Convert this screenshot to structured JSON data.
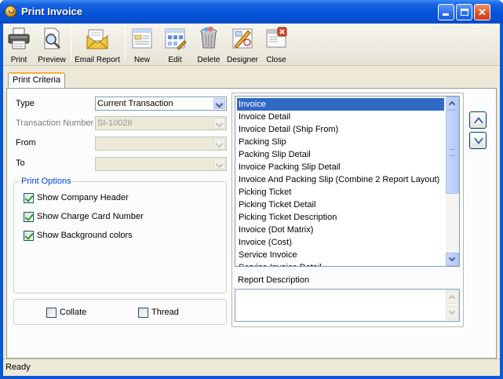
{
  "window": {
    "title": "Print Invoice"
  },
  "toolbar": {
    "print": "Print",
    "preview": "Preview",
    "email_report": "Email Report",
    "new": "New",
    "edit": "Edit",
    "delete": "Delete",
    "designer": "Designer",
    "close": "Close"
  },
  "tabs": {
    "print_criteria": "Print Criteria"
  },
  "form": {
    "type_label": "Type",
    "type_value": "Current Transaction",
    "transaction_number_label": "Transaction Number",
    "transaction_number_value": "SI-10026",
    "from_label": "From",
    "from_value": "",
    "to_label": "To",
    "to_value": ""
  },
  "print_options": {
    "legend": "Print Options",
    "items": [
      {
        "label": "Show Company Header",
        "checked": true
      },
      {
        "label": "Show Charge Card Number",
        "checked": true
      },
      {
        "label": "Show Background colors",
        "checked": true
      }
    ]
  },
  "bottom_options": {
    "collate": {
      "label": "Collate",
      "checked": false
    },
    "thread": {
      "label": "Thread",
      "checked": false
    }
  },
  "reports": {
    "selected": "Invoice",
    "items": [
      "Invoice",
      "Invoice Detail",
      "Invoice Detail (Ship From)",
      "Packing Slip",
      "Packing Slip Detail",
      "Invoice Packing Slip Detail",
      "Invoice And Packing Slip (Combine 2 Report Layout)",
      "Picking Ticket",
      "Picking Ticket Detail",
      "Picking Ticket Description",
      "Invoice (Dot Matrix)",
      "Invoice (Cost)",
      "Service Invoice",
      "Service Invoice Detail"
    ]
  },
  "report_description": {
    "label": "Report Description",
    "value": ""
  },
  "status": {
    "text": "Ready"
  },
  "colors": {
    "titlebar": "#0553d8",
    "selection": "#316ac5",
    "legend": "#0046d5",
    "face": "#ece9d8"
  }
}
